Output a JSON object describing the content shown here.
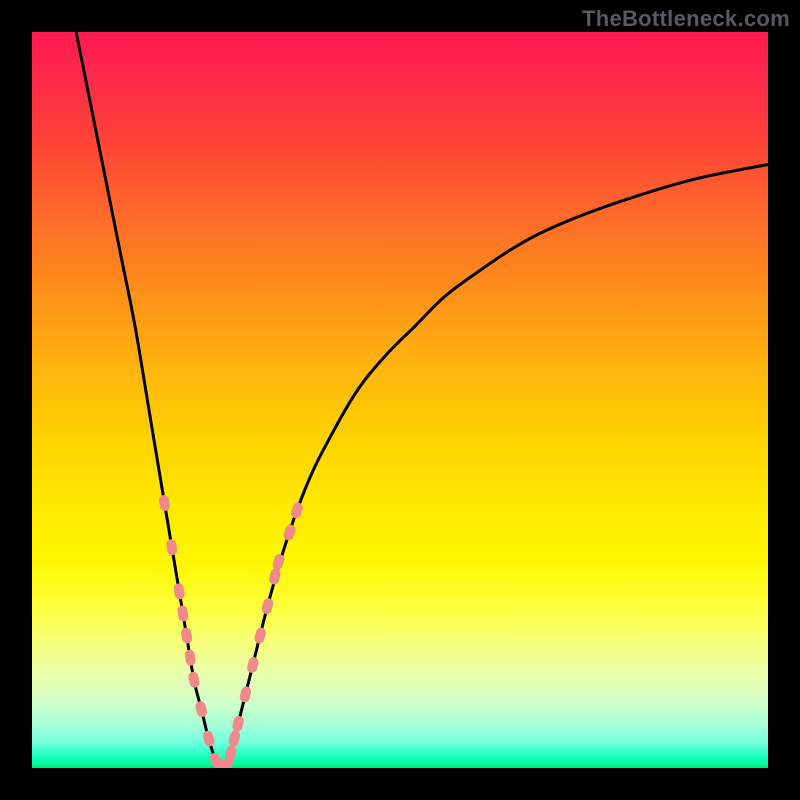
{
  "watermark": "TheBottleneck.com",
  "colors": {
    "curve_stroke": "#000000",
    "marker_fill": "#f08a8a",
    "marker_stroke": "#e07070",
    "frame": "#000000"
  },
  "chart_data": {
    "type": "line",
    "title": "",
    "xlabel": "",
    "ylabel": "",
    "xlim": [
      0,
      100
    ],
    "ylim": [
      0,
      100
    ],
    "series": [
      {
        "name": "left-branch",
        "x": [
          6,
          8,
          10,
          12,
          14,
          16,
          17,
          18,
          19,
          20,
          21,
          22,
          23,
          24,
          25,
          26
        ],
        "values": [
          100,
          90,
          80,
          70,
          60,
          48,
          42,
          36,
          30,
          24,
          18,
          12,
          8,
          4,
          1,
          0
        ]
      },
      {
        "name": "right-branch",
        "x": [
          26,
          27,
          28,
          30,
          32,
          34,
          36,
          38,
          40,
          44,
          48,
          52,
          56,
          60,
          66,
          72,
          80,
          90,
          100
        ],
        "values": [
          0,
          2,
          6,
          14,
          22,
          29,
          35,
          40,
          44,
          51,
          56,
          60,
          64,
          67,
          71,
          74,
          77,
          80,
          82
        ]
      }
    ],
    "markers": [
      {
        "branch": "left",
        "x": 18,
        "y": 36
      },
      {
        "branch": "left",
        "x": 19,
        "y": 30
      },
      {
        "branch": "left",
        "x": 20,
        "y": 24
      },
      {
        "branch": "left",
        "x": 20.5,
        "y": 21
      },
      {
        "branch": "left",
        "x": 21,
        "y": 18
      },
      {
        "branch": "left",
        "x": 21.5,
        "y": 15
      },
      {
        "branch": "left",
        "x": 22,
        "y": 12
      },
      {
        "branch": "left",
        "x": 23,
        "y": 8
      },
      {
        "branch": "left",
        "x": 24,
        "y": 4
      },
      {
        "branch": "left",
        "x": 25,
        "y": 1
      },
      {
        "branch": "left",
        "x": 25.5,
        "y": 0.5
      },
      {
        "branch": "right",
        "x": 26,
        "y": 0
      },
      {
        "branch": "right",
        "x": 26.5,
        "y": 0.5
      },
      {
        "branch": "right",
        "x": 27,
        "y": 2
      },
      {
        "branch": "right",
        "x": 27.5,
        "y": 4
      },
      {
        "branch": "right",
        "x": 28,
        "y": 6
      },
      {
        "branch": "right",
        "x": 29,
        "y": 10
      },
      {
        "branch": "right",
        "x": 30,
        "y": 14
      },
      {
        "branch": "right",
        "x": 31,
        "y": 18
      },
      {
        "branch": "right",
        "x": 32,
        "y": 22
      },
      {
        "branch": "right",
        "x": 33,
        "y": 26
      },
      {
        "branch": "right",
        "x": 33.5,
        "y": 28
      },
      {
        "branch": "right",
        "x": 35,
        "y": 32
      },
      {
        "branch": "right",
        "x": 36,
        "y": 35
      }
    ],
    "minimum_x": 26
  }
}
